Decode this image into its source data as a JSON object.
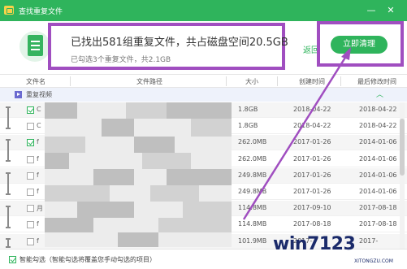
{
  "window": {
    "title": "查找重复文件",
    "minimize_glyph": "—",
    "close_glyph": "✕"
  },
  "summary": {
    "main_text": "已找出581组重复文件，共占磁盘空间20.5GB",
    "sub_text": "已勾选3个重复文件，共2.1GB"
  },
  "actions": {
    "back_label": "返回",
    "clean_label": "立即清理"
  },
  "table": {
    "columns": [
      "文件名",
      "文件路径",
      "大小",
      "创建时间",
      "最后修改时间"
    ],
    "group_label": "重复视频",
    "rows": [
      {
        "checked": true,
        "name": "C",
        "size": "1.8GB",
        "created": "2018-04-22",
        "modified": "2018-04-22"
      },
      {
        "checked": false,
        "name": "C",
        "size": "1.8GB",
        "created": "2018-04-22",
        "modified": "2018-04-22"
      },
      {
        "checked": true,
        "name": "f",
        "size": "262.0MB",
        "created": "2017-01-26",
        "modified": "2014-01-06"
      },
      {
        "checked": false,
        "name": "f",
        "size": "262.0MB",
        "created": "2017-01-26",
        "modified": "2014-01-06"
      },
      {
        "checked": false,
        "name": "f",
        "size": "249.8MB",
        "created": "2017-01-26",
        "modified": "2014-01-06"
      },
      {
        "checked": false,
        "name": "f",
        "size": "249.8MB",
        "created": "2017-01-26",
        "modified": "2014-01-06"
      },
      {
        "checked": false,
        "name": "月",
        "size": "114.8MB",
        "created": "2017-09-10",
        "modified": "2017-08-18"
      },
      {
        "checked": false,
        "name": "f",
        "size": "114.8MB",
        "created": "2017-08-18",
        "modified": "2017-08-18"
      },
      {
        "checked": false,
        "name": "f",
        "size": "101.9MB",
        "created": "2017-",
        "modified": "2017-"
      }
    ]
  },
  "footer": {
    "smart_select_text": "智能勾选（智能勾选将覆盖您手动勾选的项目）"
  },
  "watermark": {
    "text": "win7123",
    "sub": "XITONGZU.COM"
  },
  "colors": {
    "accent": "#2fb45c",
    "highlight": "#a04ec0"
  }
}
